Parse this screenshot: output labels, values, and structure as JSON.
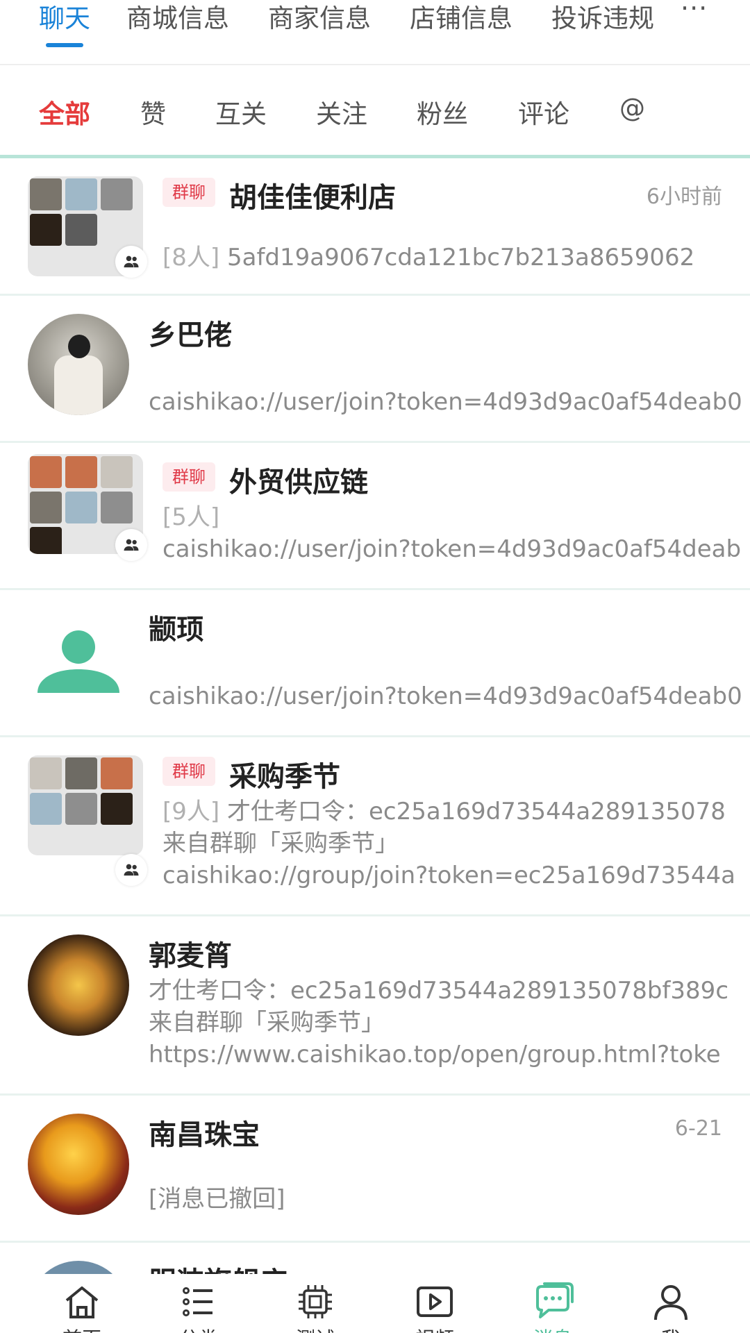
{
  "top_tabs": [
    "聊天",
    "商城信息",
    "商家信息",
    "店铺信息",
    "投诉违规"
  ],
  "top_more": "···",
  "sub_tabs": [
    "全部",
    "赞",
    "互关",
    "关注",
    "粉丝",
    "评论",
    "@"
  ],
  "chats": [
    {
      "tag": "群聊",
      "name": "胡佳佳便利店",
      "time": "6小时前",
      "count": "[8人]",
      "lines": [
        "5afd19a9067cda121bc7b213a8659062"
      ]
    },
    {
      "name": "乡巴佬",
      "lines": [
        "caishikao://user/join?token=4d93d9ac0af54deab0"
      ]
    },
    {
      "tag": "群聊",
      "name": "外贸供应链",
      "count": "[5人]",
      "lines": [
        "caishikao://user/join?token=4d93d9ac0af54deab"
      ]
    },
    {
      "name": "颛顼",
      "lines": [
        "caishikao://user/join?token=4d93d9ac0af54deab0"
      ]
    },
    {
      "tag": "群聊",
      "name": "采购季节",
      "count": "[9人]",
      "lines": [
        "才仕考口令：ec25a169d73544a289135078",
        "来自群聊「采购季节」",
        "caishikao://group/join?token=ec25a169d73544a"
      ]
    },
    {
      "name": "郭麦筲",
      "lines": [
        "才仕考口令：ec25a169d73544a289135078bf389c",
        "来自群聊「采购季节」",
        "https://www.caishikao.top/open/group.html?toke"
      ]
    },
    {
      "name": "南昌珠宝",
      "time": "6-21",
      "lines": [
        "[消息已撤回]"
      ]
    },
    {
      "name": "服装旗舰店"
    }
  ],
  "bottom_nav": [
    "首页",
    "分类",
    "测试",
    "视频",
    "消息",
    "我"
  ],
  "colors": {
    "accent_blue": "#1a83d8",
    "accent_red": "#e53b3b",
    "accent_green": "#4fbf9a",
    "divider": "#b8e4d8"
  },
  "icons": {
    "home": "home-icon",
    "category": "list-icon",
    "test": "chip-icon",
    "video": "play-icon",
    "message": "chat-bubble-icon",
    "me": "person-icon",
    "group": "group-people-icon"
  }
}
